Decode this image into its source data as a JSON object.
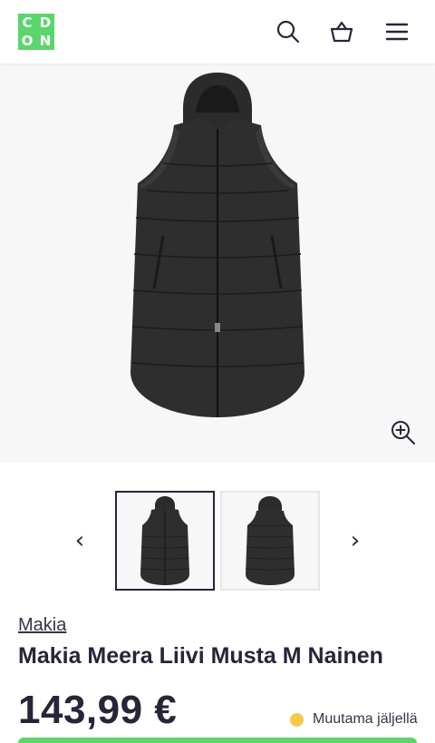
{
  "header": {
    "logo_letters": [
      "C",
      "D",
      "O",
      "N"
    ],
    "icons": [
      "search-icon",
      "basket-icon",
      "menu-icon"
    ],
    "brand_color": "#5bd66c"
  },
  "gallery": {
    "main_image": "black-long-puffer-vest",
    "zoom_icon": "zoom-in-icon",
    "prev_arrow": "‹",
    "next_arrow": "›",
    "thumbnails": [
      {
        "image": "vest-front",
        "selected": true
      },
      {
        "image": "vest-back",
        "selected": false
      }
    ]
  },
  "product": {
    "brand": "Makia",
    "title": "Makia Meera Liivi Musta M Nainen",
    "price": "143,99 €",
    "stock_text": "Muutama jäljellä",
    "stock_color": "#f6c94c"
  }
}
